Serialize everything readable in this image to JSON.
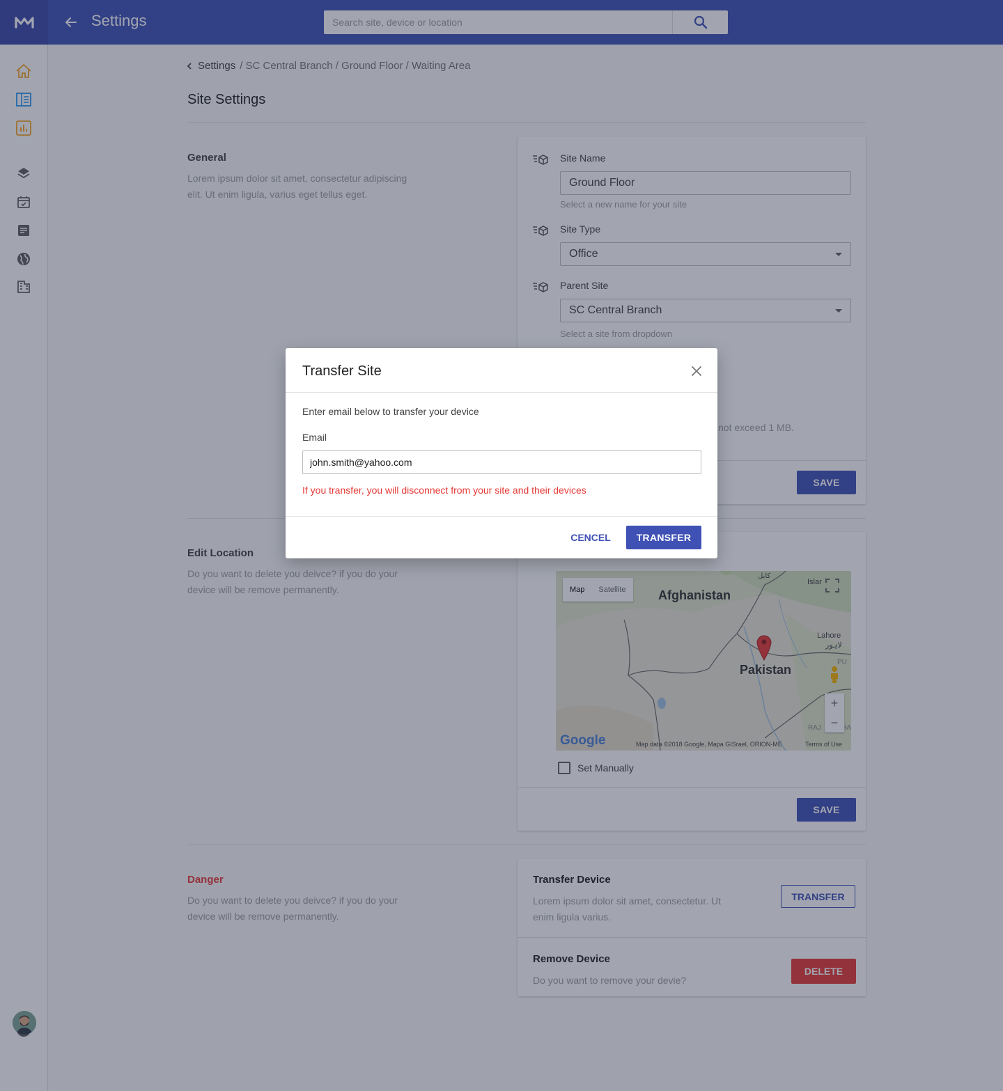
{
  "app": {
    "title": "Settings"
  },
  "search": {
    "placeholder": "Search site, device or location"
  },
  "breadcrumb": {
    "first": "Settings",
    "rest": "/ SC Central Branch / Ground Floor / Waiting Area"
  },
  "page": {
    "title": "Site Settings"
  },
  "general": {
    "title": "General",
    "description": "Lorem ipsum dolor sit amet, consectetur adipiscing elit. Ut enim ligula, varius eget tellus eget.",
    "site_name_label": "Site Name",
    "site_name_value": "Ground Floor",
    "site_name_help": "Select a new name for your site",
    "site_type_label": "Site Type",
    "site_type_value": "Office",
    "parent_site_label": "Parent Site",
    "parent_site_value": "SC Central Branch",
    "parent_site_help": "Select a site from dropdown",
    "upload_help_fragment": "not exceed 1 MB.",
    "save_label": "SAVE"
  },
  "location": {
    "title": "Edit Location",
    "description": "Do you want to delete you deivce? if you do your device will be remove permanently.",
    "map": {
      "map_tab": "Map",
      "satellite_tab": "Satellite",
      "label_afghanistan": "Afghanistan",
      "label_pakistan": "Pakistan",
      "label_lahore": "Lahore",
      "label_lahore_urdu": "لاہور",
      "label_islamabad": "Islar",
      "label_kabul": "کابل",
      "label_punjab": "PU",
      "label_raj": "RAJ",
      "label_ha": "HA",
      "google": "Google",
      "attribution": "Map data ©2018 Google, Mapa GISrael, ORION-ME",
      "terms": "Terms of Use"
    },
    "set_manually_label": "Set Manually",
    "save_label": "SAVE"
  },
  "danger": {
    "title": "Danger",
    "description": "Do you want to delete you deivce? if you do your device will be remove permanently.",
    "transfer_title": "Transfer Device",
    "transfer_desc": "Lorem ipsum dolor sit amet, consectetur. Ut enim ligula varius.",
    "transfer_button": "TRANSFER",
    "remove_title": "Remove Device",
    "remove_desc": "Do you want to remove your devie?",
    "delete_button": "DELETE"
  },
  "modal": {
    "title": "Transfer Site",
    "intro": "Enter email below to transfer your device",
    "email_label": "Email",
    "email_value": "john.smith@yahoo.com",
    "warning": "If you transfer, you will disconnect from your site and their devices",
    "cancel_label": "CENCEL",
    "transfer_label": "TRANSFER"
  },
  "colors": {
    "primary": "#3f51b5",
    "danger": "#e53935",
    "accent_orange": "#f5a623",
    "accent_blue": "#2196f3"
  },
  "icons": {
    "logo": "logo-m-icon",
    "back": "arrow-left-icon",
    "search": "search-icon",
    "sidebar": [
      "home-icon",
      "book-icon",
      "chart-icon",
      "layers-icon",
      "calendar-check-icon",
      "document-icon",
      "globe-icon",
      "building-icon"
    ],
    "help": "help-icon",
    "close": "close-icon",
    "field": "cube-list-icon"
  }
}
